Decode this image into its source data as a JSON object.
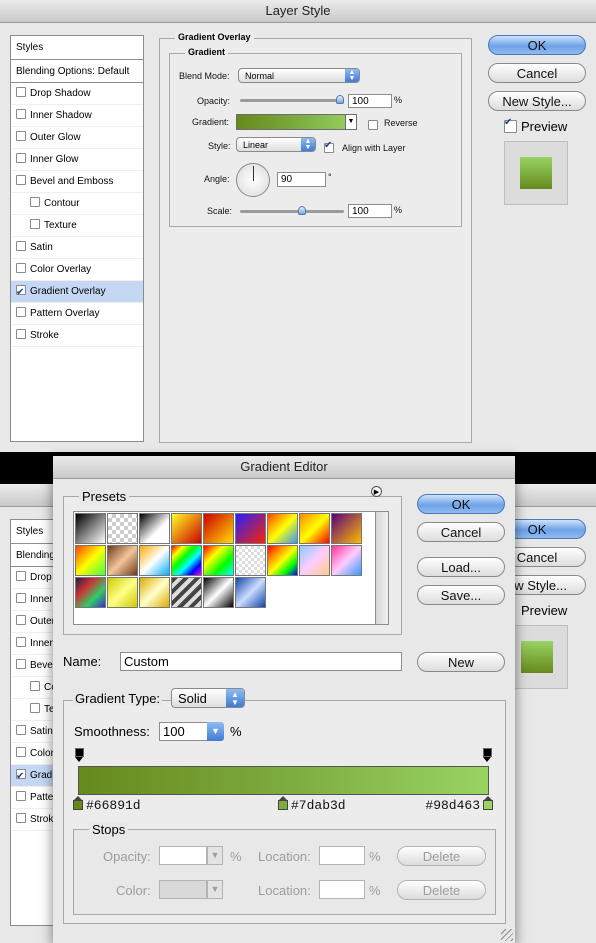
{
  "layer_style": {
    "title": "Layer Style",
    "styles_header": "Styles",
    "blending_options": "Blending Options: Default",
    "items": [
      {
        "label": "Drop Shadow",
        "checked": false,
        "indent": false,
        "selected": false
      },
      {
        "label": "Inner Shadow",
        "checked": false,
        "indent": false,
        "selected": false
      },
      {
        "label": "Outer Glow",
        "checked": false,
        "indent": false,
        "selected": false
      },
      {
        "label": "Inner Glow",
        "checked": false,
        "indent": false,
        "selected": false
      },
      {
        "label": "Bevel and Emboss",
        "checked": false,
        "indent": false,
        "selected": false
      },
      {
        "label": "Contour",
        "checked": false,
        "indent": true,
        "selected": false
      },
      {
        "label": "Texture",
        "checked": false,
        "indent": true,
        "selected": false
      },
      {
        "label": "Satin",
        "checked": false,
        "indent": false,
        "selected": false
      },
      {
        "label": "Color Overlay",
        "checked": false,
        "indent": false,
        "selected": false
      },
      {
        "label": "Gradient Overlay",
        "checked": true,
        "indent": false,
        "selected": true
      },
      {
        "label": "Pattern Overlay",
        "checked": false,
        "indent": false,
        "selected": false
      },
      {
        "label": "Stroke",
        "checked": false,
        "indent": false,
        "selected": false
      }
    ],
    "group_title": "Gradient Overlay",
    "sub_title": "Gradient",
    "blend_mode_label": "Blend Mode:",
    "blend_mode_value": "Normal",
    "opacity_label": "Opacity:",
    "opacity_value": "100",
    "opacity_pct": 100,
    "percent": "%",
    "gradient_label": "Gradient:",
    "reverse_label": "Reverse",
    "style_label": "Style:",
    "style_value": "Linear",
    "align_label": "Align with Layer",
    "angle_label": "Angle:",
    "angle_value": "90",
    "degree": "°",
    "scale_label": "Scale:",
    "scale_value": "100",
    "buttons": {
      "ok": "OK",
      "cancel": "Cancel",
      "new_style": "New Style..."
    },
    "preview_label": "Preview"
  },
  "back_dialog": {
    "styles_header": "Styles",
    "blending_options": "Blending",
    "items": [
      {
        "label": "Drop",
        "checked": false,
        "indent": false,
        "selected": false
      },
      {
        "label": "Inner",
        "checked": false,
        "indent": false,
        "selected": false
      },
      {
        "label": "Outer",
        "checked": false,
        "indent": false,
        "selected": false
      },
      {
        "label": "Inner",
        "checked": false,
        "indent": false,
        "selected": false
      },
      {
        "label": "Bevel",
        "checked": false,
        "indent": false,
        "selected": false
      },
      {
        "label": "Co",
        "checked": false,
        "indent": true,
        "selected": false
      },
      {
        "label": "Te",
        "checked": false,
        "indent": true,
        "selected": false
      },
      {
        "label": "Satin",
        "checked": false,
        "indent": false,
        "selected": false
      },
      {
        "label": "Color",
        "checked": false,
        "indent": false,
        "selected": false
      },
      {
        "label": "Grad",
        "checked": true,
        "indent": false,
        "selected": true
      },
      {
        "label": "Patte",
        "checked": false,
        "indent": false,
        "selected": false
      },
      {
        "label": "Strok",
        "checked": false,
        "indent": false,
        "selected": false
      }
    ],
    "ok": "OK",
    "cancel": "Cancel",
    "new_style": "ew Style...",
    "preview": "Preview"
  },
  "gradient_editor": {
    "title": "Gradient Editor",
    "presets_label": "Presets",
    "buttons": {
      "ok": "OK",
      "cancel": "Cancel",
      "load": "Load...",
      "save": "Save...",
      "new": "New",
      "delete": "Delete"
    },
    "name_label": "Name:",
    "name_value": "Custom",
    "gradient_type_label": "Gradient Type:",
    "gradient_type_value": "Solid",
    "smoothness_label": "Smoothness:",
    "smoothness_value": "100",
    "percent": "%",
    "color_stops": [
      {
        "hex": "#66891d",
        "location": 0
      },
      {
        "hex": "#7dab3d",
        "location": 50
      },
      {
        "hex": "#98d463",
        "location": 100
      }
    ],
    "stops_label": "Stops",
    "opacity_label": "Opacity:",
    "location_label": "Location:",
    "color_label": "Color:"
  },
  "colors": {
    "accent": "#6ea3e8",
    "gradient_start": "#66891d",
    "gradient_mid": "#7dab3d",
    "gradient_end": "#98d463",
    "preview_fill": "#6f9d33"
  }
}
